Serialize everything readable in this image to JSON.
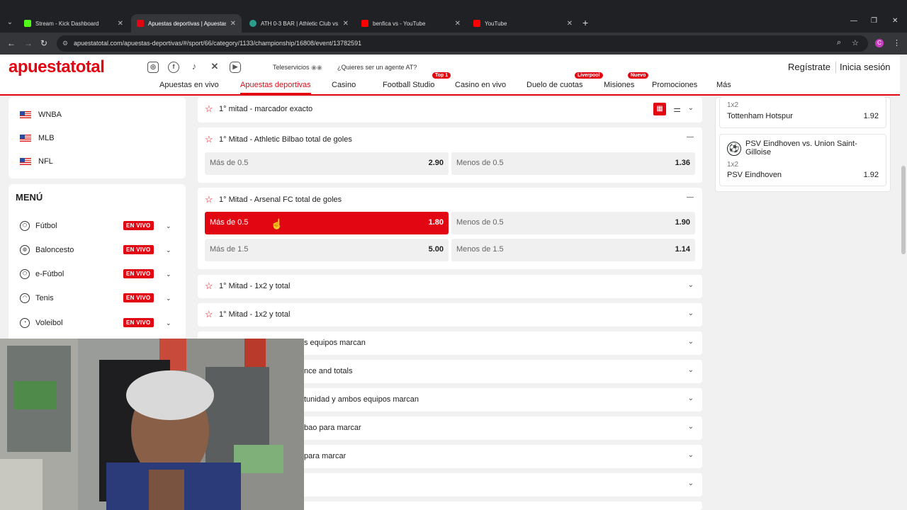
{
  "browser": {
    "tabs": [
      {
        "title": "Stream - Kick Dashboard",
        "color": "#53fc18"
      },
      {
        "title": "Apuestas deportivas | Apuestas",
        "color": "#e20613"
      },
      {
        "title": "ATH 0-3 BAR | Athletic Club vs. B",
        "color": "#2a9d8f"
      },
      {
        "title": "benfica vs - YouTube",
        "color": "#ff0000"
      },
      {
        "title": "YouTube",
        "color": "#ff0000"
      }
    ],
    "url": "apuestatotal.com/apuestas-deportivas/#/sport/66/category/1133/championship/16808/event/13782591",
    "profile_initial": "C"
  },
  "header": {
    "logo": "apuestatotal",
    "teleservicios": "Teleservicios",
    "agent_question": "¿Quieres ser un agente AT?",
    "register": "Regístrate",
    "login": "Inicia sesión",
    "nav": [
      "Apuestas en vivo",
      "Apuestas deportivas",
      "Casino",
      "Football Studio",
      "Casino en vivo",
      "Duelo de cuotas",
      "Misiones",
      "Promociones",
      "Más"
    ],
    "badges": {
      "football_studio": "Top 1",
      "duelo": "Liverpool",
      "misiones": "Nuevo"
    }
  },
  "sidebar": {
    "leagues": [
      "WNBA",
      "MLB",
      "NFL"
    ],
    "menu_title": "MENÚ",
    "sports": [
      {
        "name": "Fútbol",
        "badge": "EN VIVO"
      },
      {
        "name": "Baloncesto",
        "badge": "EN VIVO"
      },
      {
        "name": "e-Fútbol",
        "badge": "EN VIVO"
      },
      {
        "name": "Tenis",
        "badge": "EN VIVO"
      },
      {
        "name": "Voleibol",
        "badge": "EN VIVO"
      }
    ]
  },
  "markets": [
    {
      "title": "1° mitad - marcador exacto"
    },
    {
      "title": "1° Mitad - Athletic Bilbao total de goles",
      "odds": [
        {
          "label": "Más de 0.5",
          "value": "2.90"
        },
        {
          "label": "Menos de 0.5",
          "value": "1.36"
        }
      ]
    },
    {
      "title": "1° Mitad - Arsenal FC total de goles",
      "odds": [
        {
          "label": "Más de 0.5",
          "value": "1.80"
        },
        {
          "label": "Menos de 0.5",
          "value": "1.90"
        },
        {
          "label": "Más de 1.5",
          "value": "5.00"
        },
        {
          "label": "Menos de 1.5",
          "value": "1.14"
        }
      ]
    },
    {
      "title": "1° Mitad - 1x2 y total"
    },
    {
      "title": "1° Mitad - 1x2 y total"
    },
    {
      "title": "s equipos marcan"
    },
    {
      "title": "nce and totals"
    },
    {
      "title": "tunidad y ambos equipos marcan"
    },
    {
      "title": "bao para marcar"
    },
    {
      "title": "para marcar"
    },
    {
      "title": ""
    }
  ],
  "betslip": {
    "items": [
      {
        "market": "1x2",
        "selection": "Tottenham Hotspur",
        "odd": "1.92"
      },
      {
        "event": "PSV Eindhoven vs. Union Saint-Gilloise",
        "market": "1x2",
        "selection": "PSV Eindhoven",
        "odd": "1.92"
      }
    ]
  }
}
